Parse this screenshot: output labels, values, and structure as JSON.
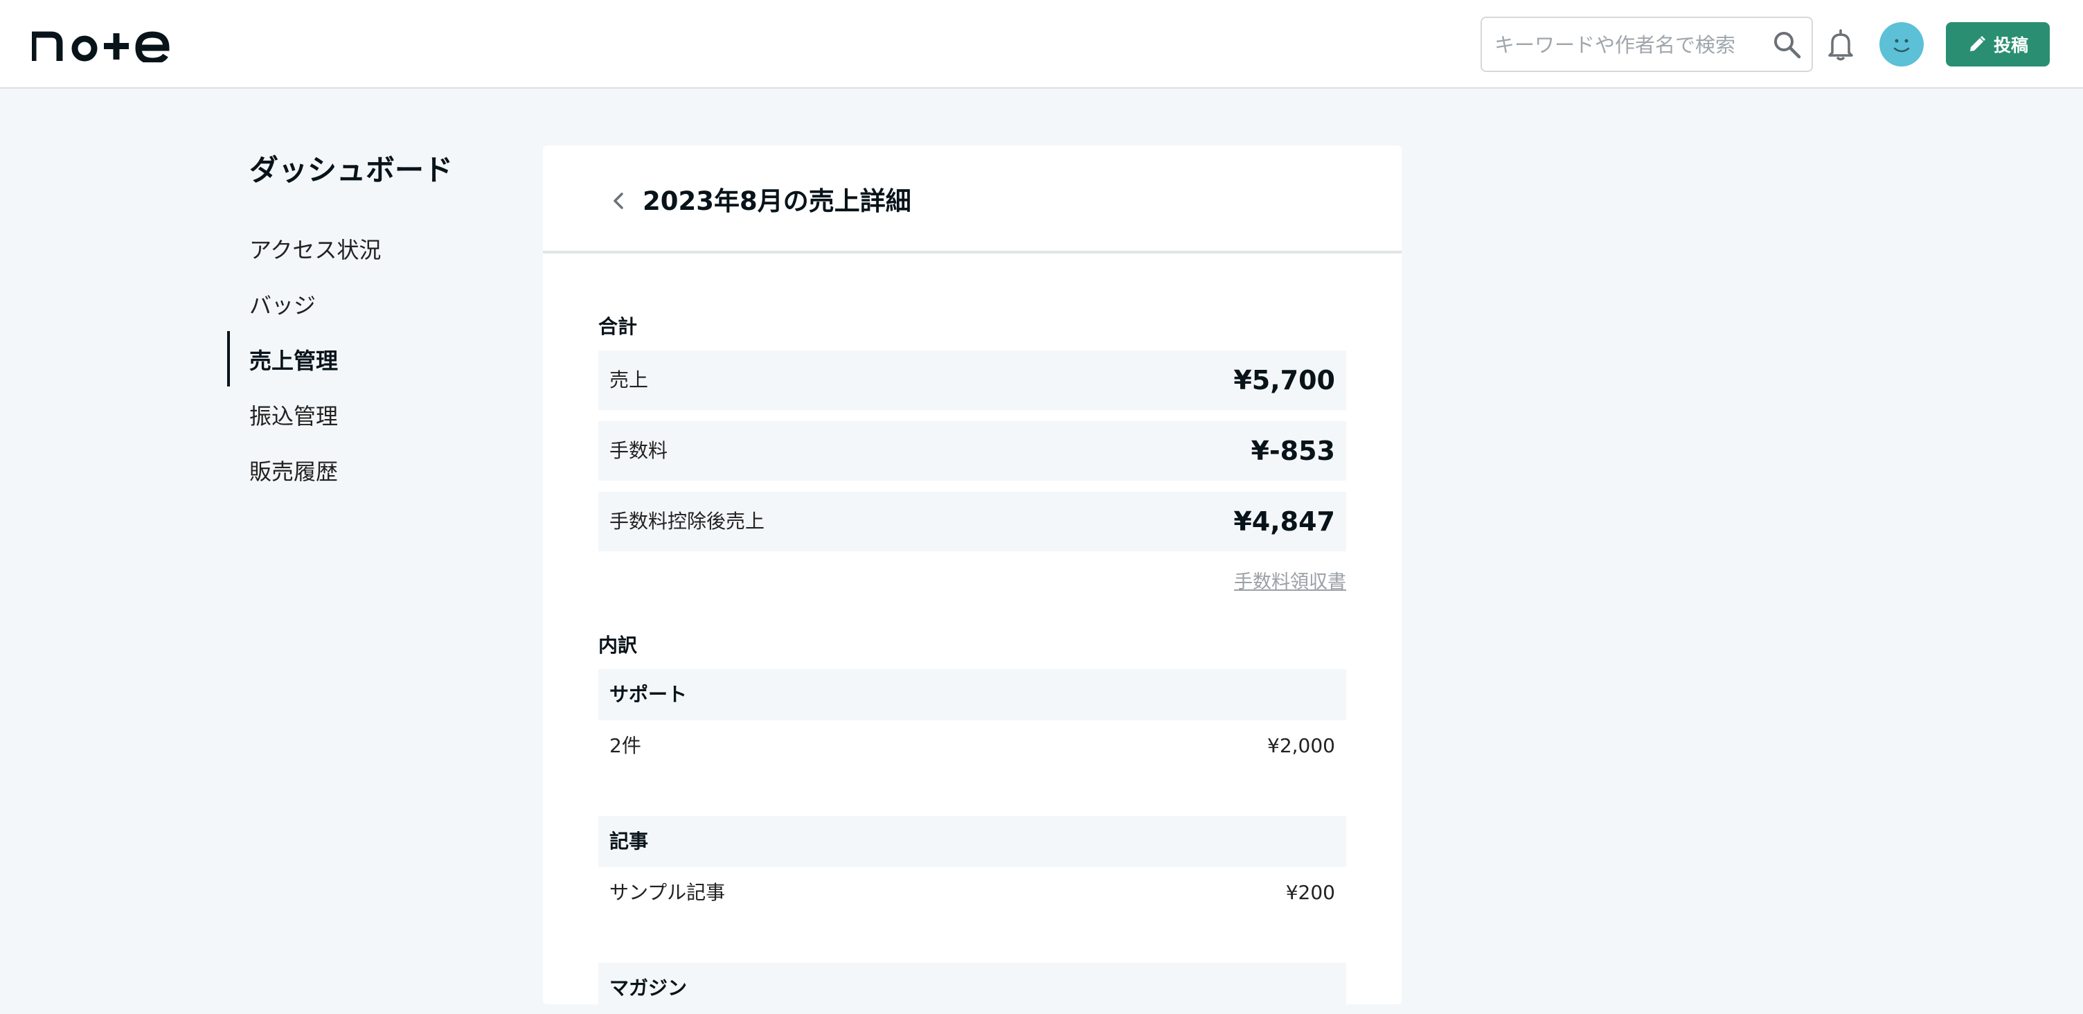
{
  "header": {
    "logo": "note",
    "search_placeholder": "キーワードや作者名で検索",
    "post_label": "投稿"
  },
  "sidebar": {
    "title": "ダッシュボード",
    "items": [
      {
        "label": "アクセス状況"
      },
      {
        "label": "バッジ"
      },
      {
        "label": "売上管理"
      },
      {
        "label": "振込管理"
      },
      {
        "label": "販売履歴"
      }
    ],
    "active": "売上管理"
  },
  "main": {
    "title": "2023年8月の売上詳細",
    "total_label": "合計",
    "summary": [
      {
        "label": "売上",
        "value": "¥5,700"
      },
      {
        "label": "手数料",
        "value": "¥-853"
      },
      {
        "label": "手数料控除後売上",
        "value": "¥4,847"
      }
    ],
    "receipt_link": "手数料領収書",
    "breakdown_label": "内訳",
    "categories": [
      {
        "name": "サポート",
        "row_label": "2件",
        "row_value": "¥2,000"
      },
      {
        "name": "記事",
        "row_label": "サンプル記事",
        "row_value": "¥200"
      },
      {
        "name": "マガジン"
      }
    ]
  },
  "colors": {
    "accent": "#2a8f72",
    "background": "#f4f7f9",
    "avatar": "#5cc0d6",
    "text": "#08131a"
  }
}
